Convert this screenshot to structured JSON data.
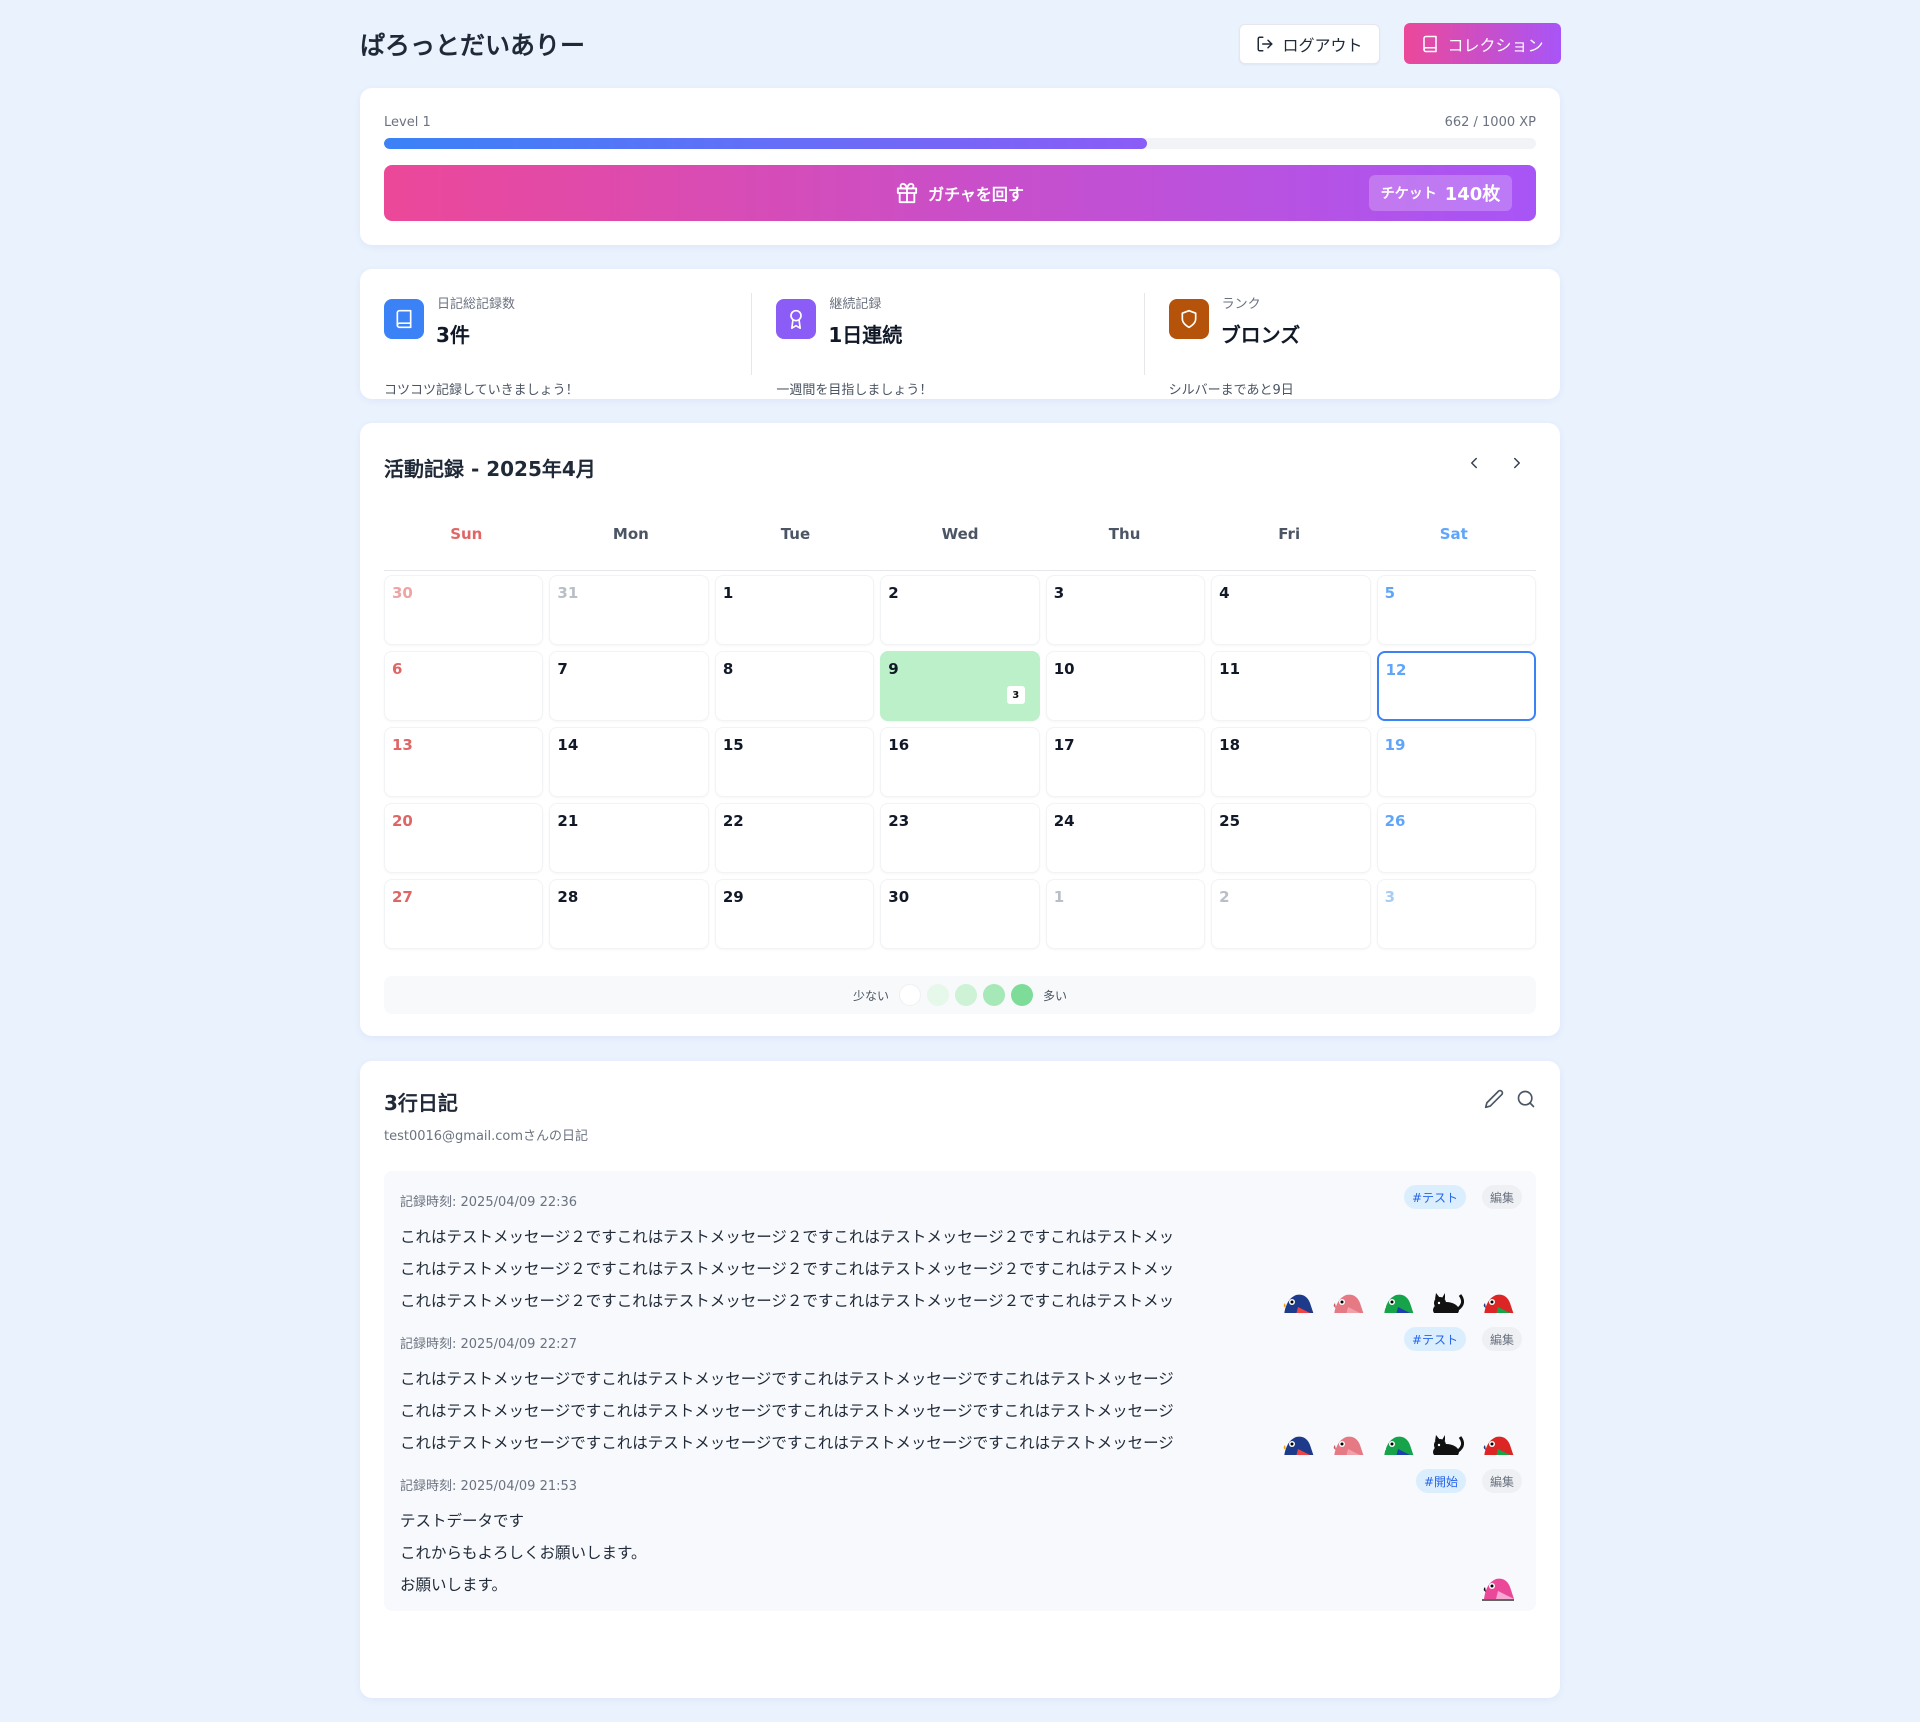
{
  "header": {
    "title": "ぱろっとだいありー",
    "logout_label": "ログアウト",
    "collection_label": "コレクション"
  },
  "level": {
    "label": "Level 1",
    "xp_text": "662 / 1000 XP",
    "xp_fraction": 0.662,
    "gacha_label": "ガチャを回す",
    "ticket_label": "チケット",
    "ticket_value": "140枚"
  },
  "stats": [
    {
      "label": "日記総記録数",
      "value": "3件",
      "sub": "コツコツ記録していきましょう！",
      "icon": "book-icon",
      "color": "#3b82f6"
    },
    {
      "label": "継続記録",
      "value": "1日連続",
      "sub": "一週間を目指しましょう！",
      "icon": "award-icon",
      "color": "#8b5cf6"
    },
    {
      "label": "ランク",
      "value": "ブロンズ",
      "sub": "シルバーまであと9日",
      "icon": "shield-icon",
      "color": "#b45309"
    }
  ],
  "calendar": {
    "title": "活動記録 - 2025年4月",
    "weekdays": [
      "Sun",
      "Mon",
      "Tue",
      "Wed",
      "Thu",
      "Fri",
      "Sat"
    ],
    "days": [
      {
        "d": "30",
        "other": true
      },
      {
        "d": "31",
        "other": true
      },
      {
        "d": "1"
      },
      {
        "d": "2"
      },
      {
        "d": "3"
      },
      {
        "d": "4"
      },
      {
        "d": "5"
      },
      {
        "d": "6"
      },
      {
        "d": "7"
      },
      {
        "d": "8"
      },
      {
        "d": "9",
        "count": "3"
      },
      {
        "d": "10"
      },
      {
        "d": "11"
      },
      {
        "d": "12",
        "today": true
      },
      {
        "d": "13"
      },
      {
        "d": "14"
      },
      {
        "d": "15"
      },
      {
        "d": "16"
      },
      {
        "d": "17"
      },
      {
        "d": "18"
      },
      {
        "d": "19"
      },
      {
        "d": "20"
      },
      {
        "d": "21"
      },
      {
        "d": "22"
      },
      {
        "d": "23"
      },
      {
        "d": "24"
      },
      {
        "d": "25"
      },
      {
        "d": "26"
      },
      {
        "d": "27"
      },
      {
        "d": "28"
      },
      {
        "d": "29"
      },
      {
        "d": "30"
      },
      {
        "d": "1",
        "other": true
      },
      {
        "d": "2",
        "other": true
      },
      {
        "d": "3",
        "other": true
      }
    ],
    "legend_less": "少ない",
    "legend_more": "多い",
    "legend_colors": [
      "#ffffff",
      "#e6f8ea",
      "#cdf2d6",
      "#a7e8b8",
      "#7ddc98"
    ]
  },
  "diary": {
    "title": "3行日記",
    "subtitle": "test0016@gmail.comさんの日記",
    "edit_label": "編集",
    "entries": [
      {
        "time": "記録時刻: 2025/04/09 22:36",
        "tag": "#テスト",
        "lines": [
          "これはテストメッセージ２ですこれはテストメッセージ２ですこれはテストメッセージ２ですこれはテストメッ",
          "これはテストメッセージ２ですこれはテストメッセージ２ですこれはテストメッセージ２ですこれはテストメッ",
          "これはテストメッセージ２ですこれはテストメッセージ２ですこれはテストメッセージ２ですこれはテストメッ"
        ],
        "birds": [
          "rainbow-parrot",
          "pink-parrot",
          "green-parrot",
          "black-cat",
          "red-parrot"
        ]
      },
      {
        "time": "記録時刻: 2025/04/09 22:27",
        "tag": "#テスト",
        "lines": [
          "これはテストメッセージですこれはテストメッセージですこれはテストメッセージですこれはテストメッセージ",
          "これはテストメッセージですこれはテストメッセージですこれはテストメッセージですこれはテストメッセージ",
          "これはテストメッセージですこれはテストメッセージですこれはテストメッセージですこれはテストメッセージ"
        ],
        "birds": [
          "rainbow-parrot",
          "pink-parrot",
          "green-parrot",
          "black-cat",
          "red-parrot"
        ]
      },
      {
        "time": "記録時刻: 2025/04/09 21:53",
        "tag": "#開始",
        "lines": [
          "テストデータです",
          "これからもよろしくお願いします。",
          "お願いします。"
        ],
        "birds": [
          "magenta-parrot"
        ]
      }
    ]
  }
}
